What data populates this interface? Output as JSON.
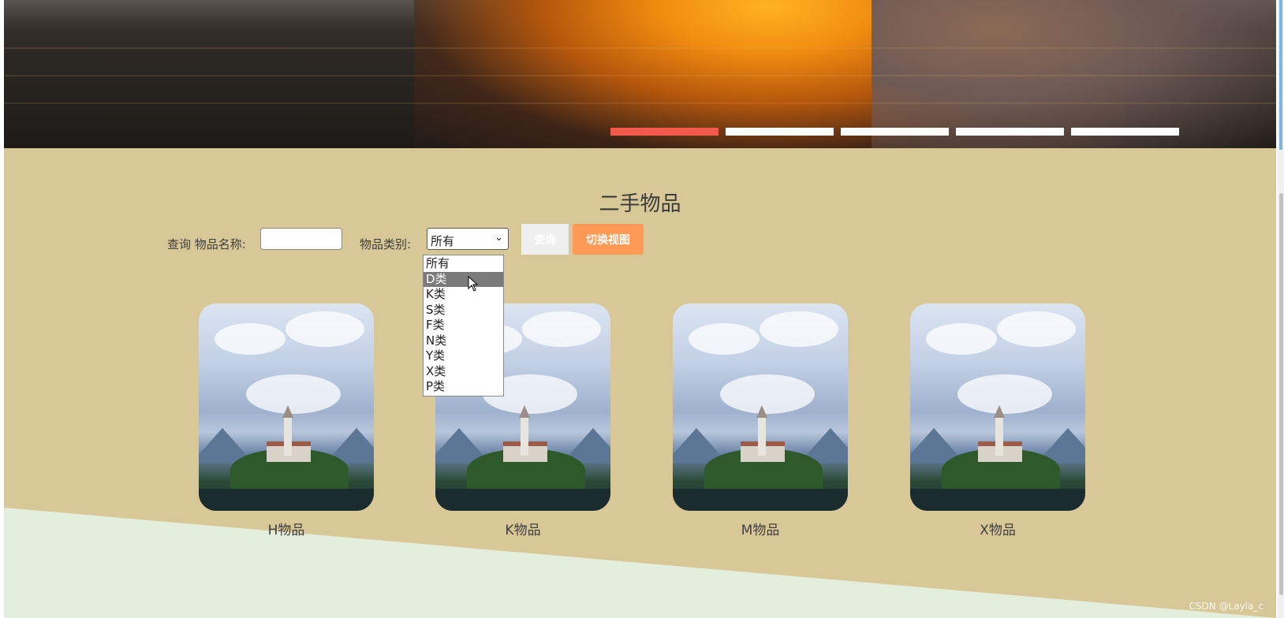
{
  "banner": {
    "indicators": [
      {
        "active": true
      },
      {
        "active": false
      },
      {
        "active": false
      },
      {
        "active": false
      },
      {
        "active": false
      }
    ],
    "accent_color": "#f25a4b"
  },
  "section": {
    "title": "二手物品"
  },
  "search": {
    "query_label": "查询 物品名称:",
    "name_value": "",
    "category_label": "物品类别:",
    "category_selected": "所有",
    "query_button": "查询",
    "switch_button": "切换视图",
    "switch_button_color": "#ff9a56"
  },
  "dropdown": {
    "options": [
      "所有",
      "D类",
      "K类",
      "S类",
      "F类",
      "N类",
      "Y类",
      "X类",
      "P类"
    ],
    "highlighted": "D类"
  },
  "items": [
    {
      "name": "H物品",
      "image_icon": "castle-lake-image"
    },
    {
      "name": "K物品",
      "image_icon": "castle-lake-image"
    },
    {
      "name": "M物品",
      "image_icon": "castle-lake-image"
    },
    {
      "name": "X物品",
      "image_icon": "castle-lake-image"
    }
  ],
  "watermark": "CSDN @Layla_c",
  "colors": {
    "content_bg": "#d8c797",
    "footer_bg": "#e3eedc"
  }
}
